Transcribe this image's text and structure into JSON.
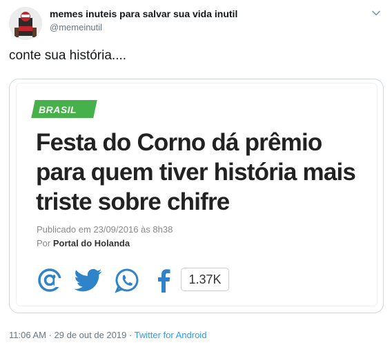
{
  "author": {
    "name": "memes inuteis para salvar sua vida inutil",
    "handle": "@memeinutil"
  },
  "tweet": {
    "text": "conte sua história....",
    "timestamp": "11:06 AM · 29 de out de 2019 · ",
    "source": "Twitter for Android"
  },
  "card": {
    "category": "BRASIL",
    "headline": "Festa do Corno dá prêmio para quem tiver história mais triste sobre chifre",
    "published": "Publicado em 23/09/2016 às 8h38",
    "by_prefix": "Por ",
    "by_source": "Portal do Holanda",
    "share_count": "1.37K",
    "share_icons": [
      "at-icon",
      "twitter-bird-icon",
      "whatsapp-icon",
      "facebook-icon"
    ]
  },
  "colors": {
    "badge_green": "#46b14a",
    "share_blue": "#2f83c8",
    "link_blue": "#1da1f2",
    "muted_gray": "#657786"
  }
}
